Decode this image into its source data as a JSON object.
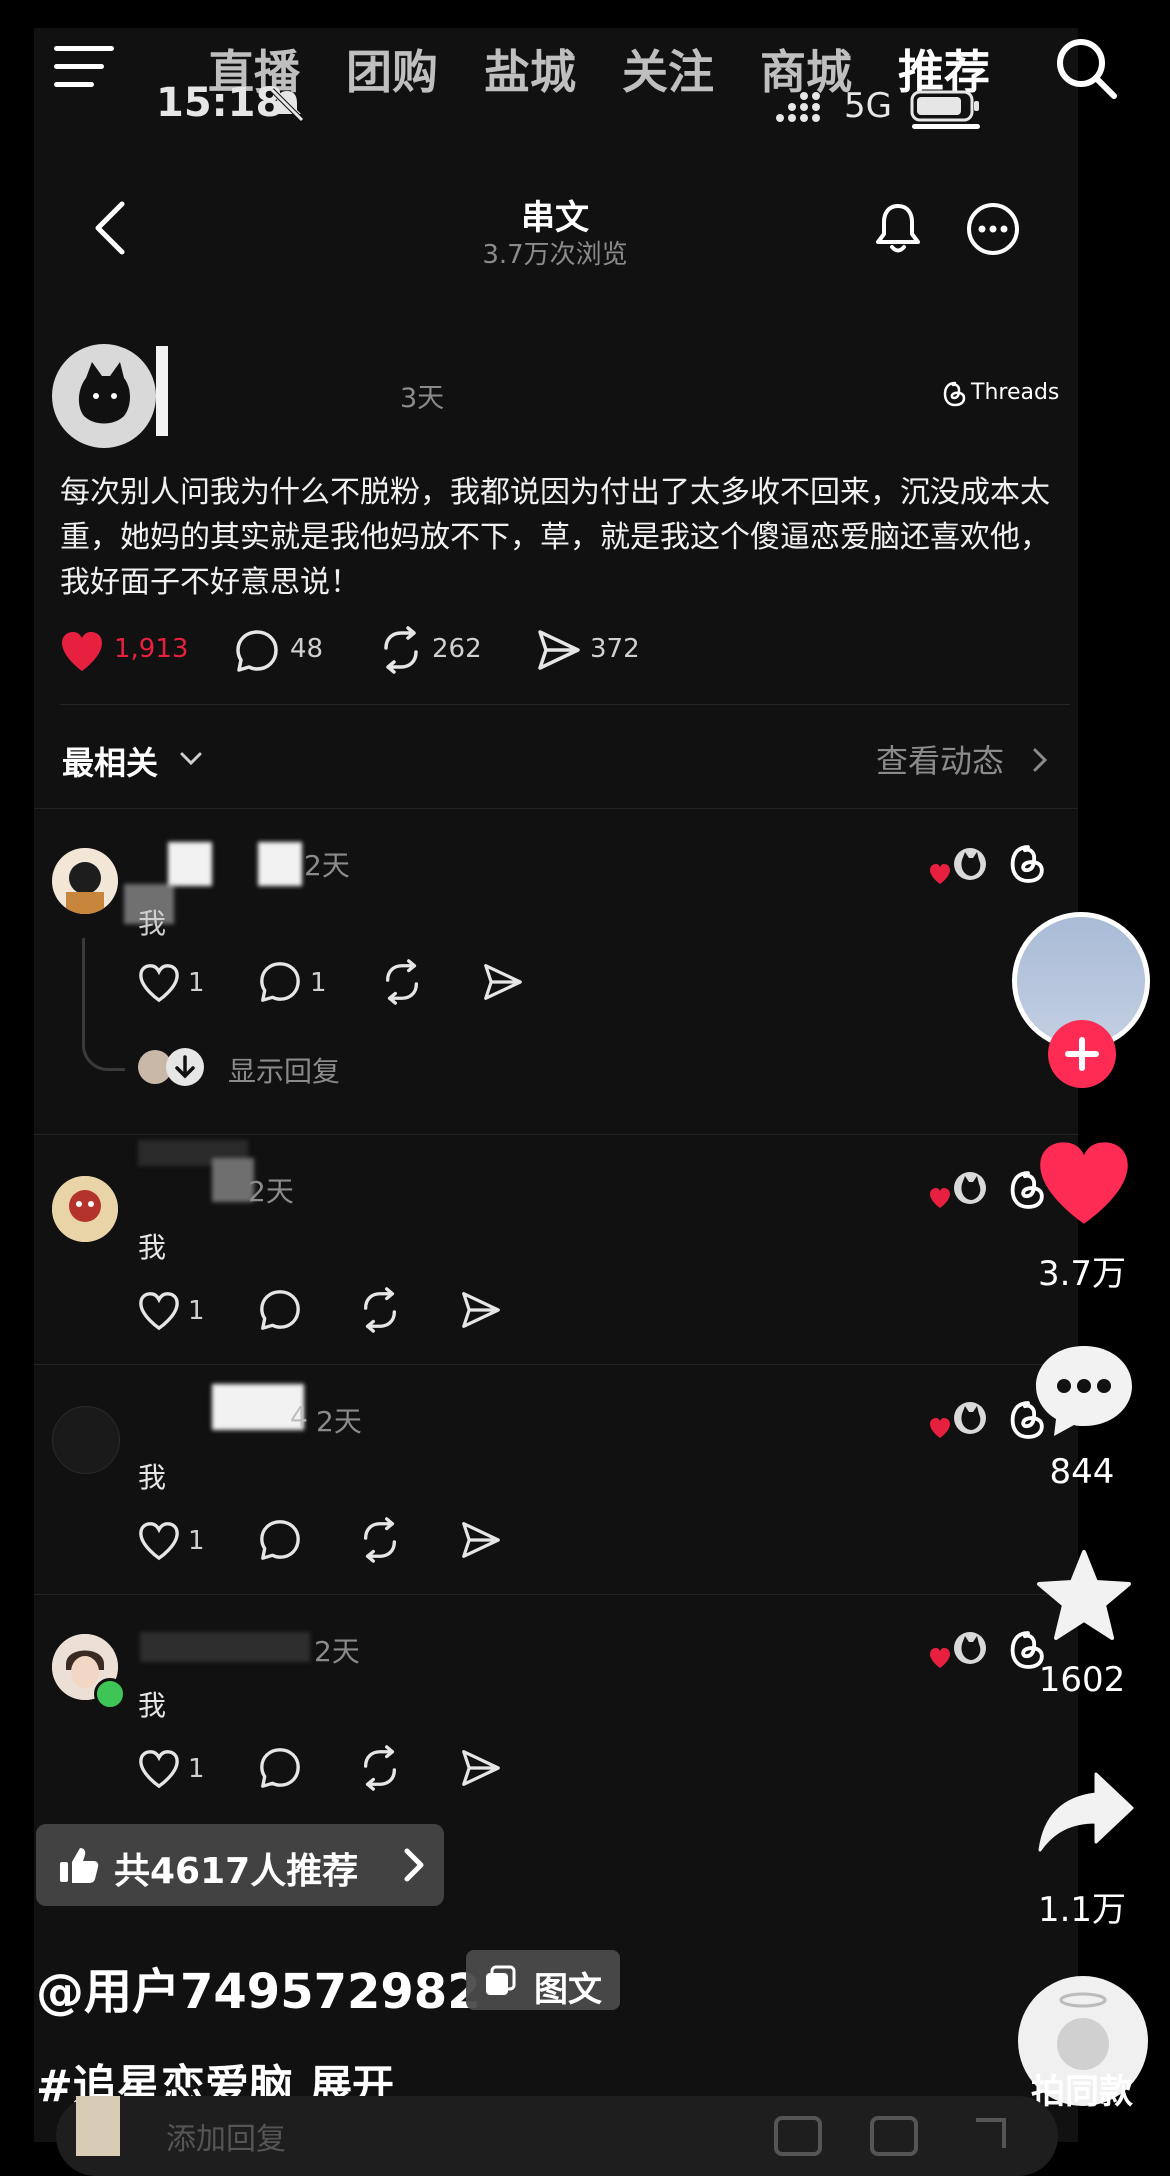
{
  "colors": {
    "accent": "#fe2c55",
    "like_red": "#e8203f",
    "bg": "#111111"
  },
  "top_nav": {
    "menu_icon": "hamburger-icon",
    "tabs": [
      "直播",
      "团购",
      "盐城",
      "关注",
      "商城",
      "推荐"
    ],
    "active_tab": "推荐",
    "search_icon": "search-icon"
  },
  "status_bar": {
    "time": "15:18",
    "network": "5G"
  },
  "header": {
    "title": "串文",
    "views": "3.7万次浏览"
  },
  "post": {
    "time_ago": "3天",
    "source": "Threads",
    "body": "每次别人问我为什么不脱粉，我都说因为付出了太多收不回来，沉没成本太重，她妈的其实就是我他妈放不下，草，就是我这个傻逼恋爱脑还喜欢他，我好面子不好意思说！",
    "likes": "1,913",
    "comments": "48",
    "reposts": "262",
    "shares": "372"
  },
  "sort": {
    "label": "最相关",
    "view_activity": "查看动态"
  },
  "comments": [
    {
      "time": "2天",
      "text": "我",
      "likes": "1",
      "replies": "1",
      "show_replies": "显示回复"
    },
    {
      "time": "2天",
      "text": "我",
      "likes": "1",
      "replies": ""
    },
    {
      "time": "2天",
      "text": "我",
      "likes": "1",
      "replies": "",
      "name_suffix": "4"
    },
    {
      "time": "2天",
      "text": "我",
      "likes": "1",
      "replies": ""
    }
  ],
  "right_actions": {
    "likes": "3.7万",
    "comments": "844",
    "favorites": "1602",
    "shares": "1.1万",
    "same_style": "拍同款"
  },
  "bottom": {
    "recommend": "共4617人推荐",
    "username": "@用户749572982",
    "type_badge": "图文",
    "hashtag": "#追星恋爱脑",
    "expand": "展开",
    "reply_placeholder": "添加回复"
  }
}
